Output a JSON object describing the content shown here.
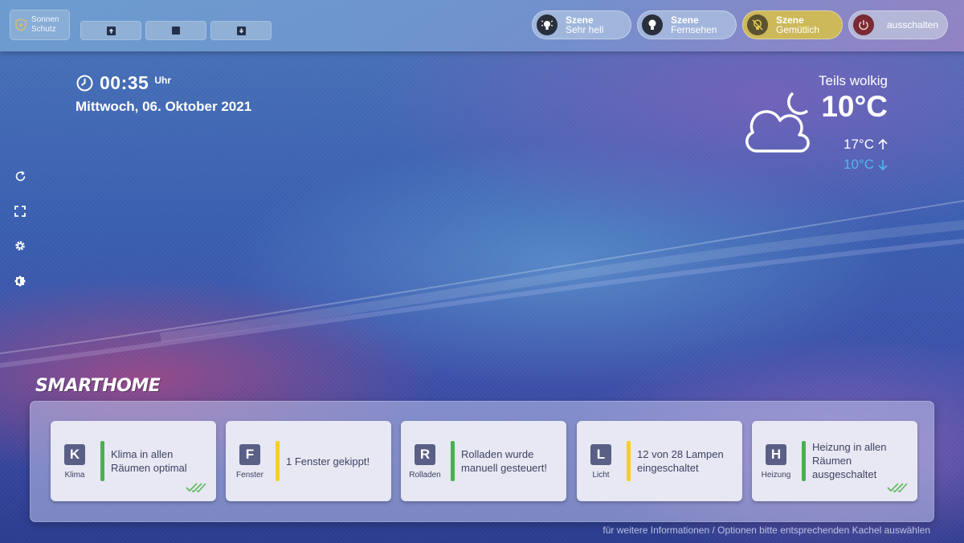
{
  "topbar": {
    "sun_button": {
      "line1": "Sonnen",
      "line2": "Schutz",
      "icon": "shield-star-icon"
    },
    "shutter_buttons": [
      {
        "name": "shutter-up-button",
        "icon": "arrow-up-icon"
      },
      {
        "name": "shutter-stop-button",
        "icon": "stop-icon"
      },
      {
        "name": "shutter-down-button",
        "icon": "arrow-down-icon"
      }
    ],
    "scenes": [
      {
        "title": "Szene",
        "subtitle": "Sehr hell",
        "icon": "lightbulb-bright-icon"
      },
      {
        "title": "Szene",
        "subtitle": "Fernsehen",
        "icon": "lightbulb-icon"
      },
      {
        "title": "Szene",
        "subtitle": "Gemütlich",
        "icon": "lightbulb-off-icon",
        "active": true
      }
    ],
    "off_button": {
      "label": "ausschalten",
      "icon": "power-icon"
    }
  },
  "clock": {
    "time": "00:35",
    "unit": "Uhr",
    "date": "Mittwoch, 06. Oktober 2021"
  },
  "weather": {
    "condition": "Teils wolkig",
    "temperature": "10°C",
    "high": "17°C",
    "low": "10°C",
    "icon": "cloud-moon-icon",
    "low_color": "#52b6ee"
  },
  "side_icons": [
    "refresh-icon",
    "fullscreen-icon",
    "settings-icon",
    "brightness-icon"
  ],
  "smarthome": {
    "title": "SMARTHOME",
    "tiles": [
      {
        "letter": "K",
        "name": "Klima",
        "message": "Klima in allen Räumen optimal",
        "status_color": "#4caf50",
        "checked": true
      },
      {
        "letter": "F",
        "name": "Fenster",
        "message": "1 Fenster gekippt!",
        "status_color": "#f5d020",
        "checked": false
      },
      {
        "letter": "R",
        "name": "Rolladen",
        "message": "Rolladen wurde manuell gesteuert!",
        "status_color": "#4caf50",
        "checked": false
      },
      {
        "letter": "L",
        "name": "Licht",
        "message": "12 von 28 Lampen eingeschaltet",
        "status_color": "#f5d020",
        "checked": false
      },
      {
        "letter": "H",
        "name": "Heizung",
        "message": "Heizung in allen Räumen ausgeschaltet",
        "status_color": "#4caf50",
        "checked": true
      }
    ]
  },
  "footer": {
    "note": "für weitere Informationen / Optionen bitte entsprechenden Kachel auswählen"
  }
}
